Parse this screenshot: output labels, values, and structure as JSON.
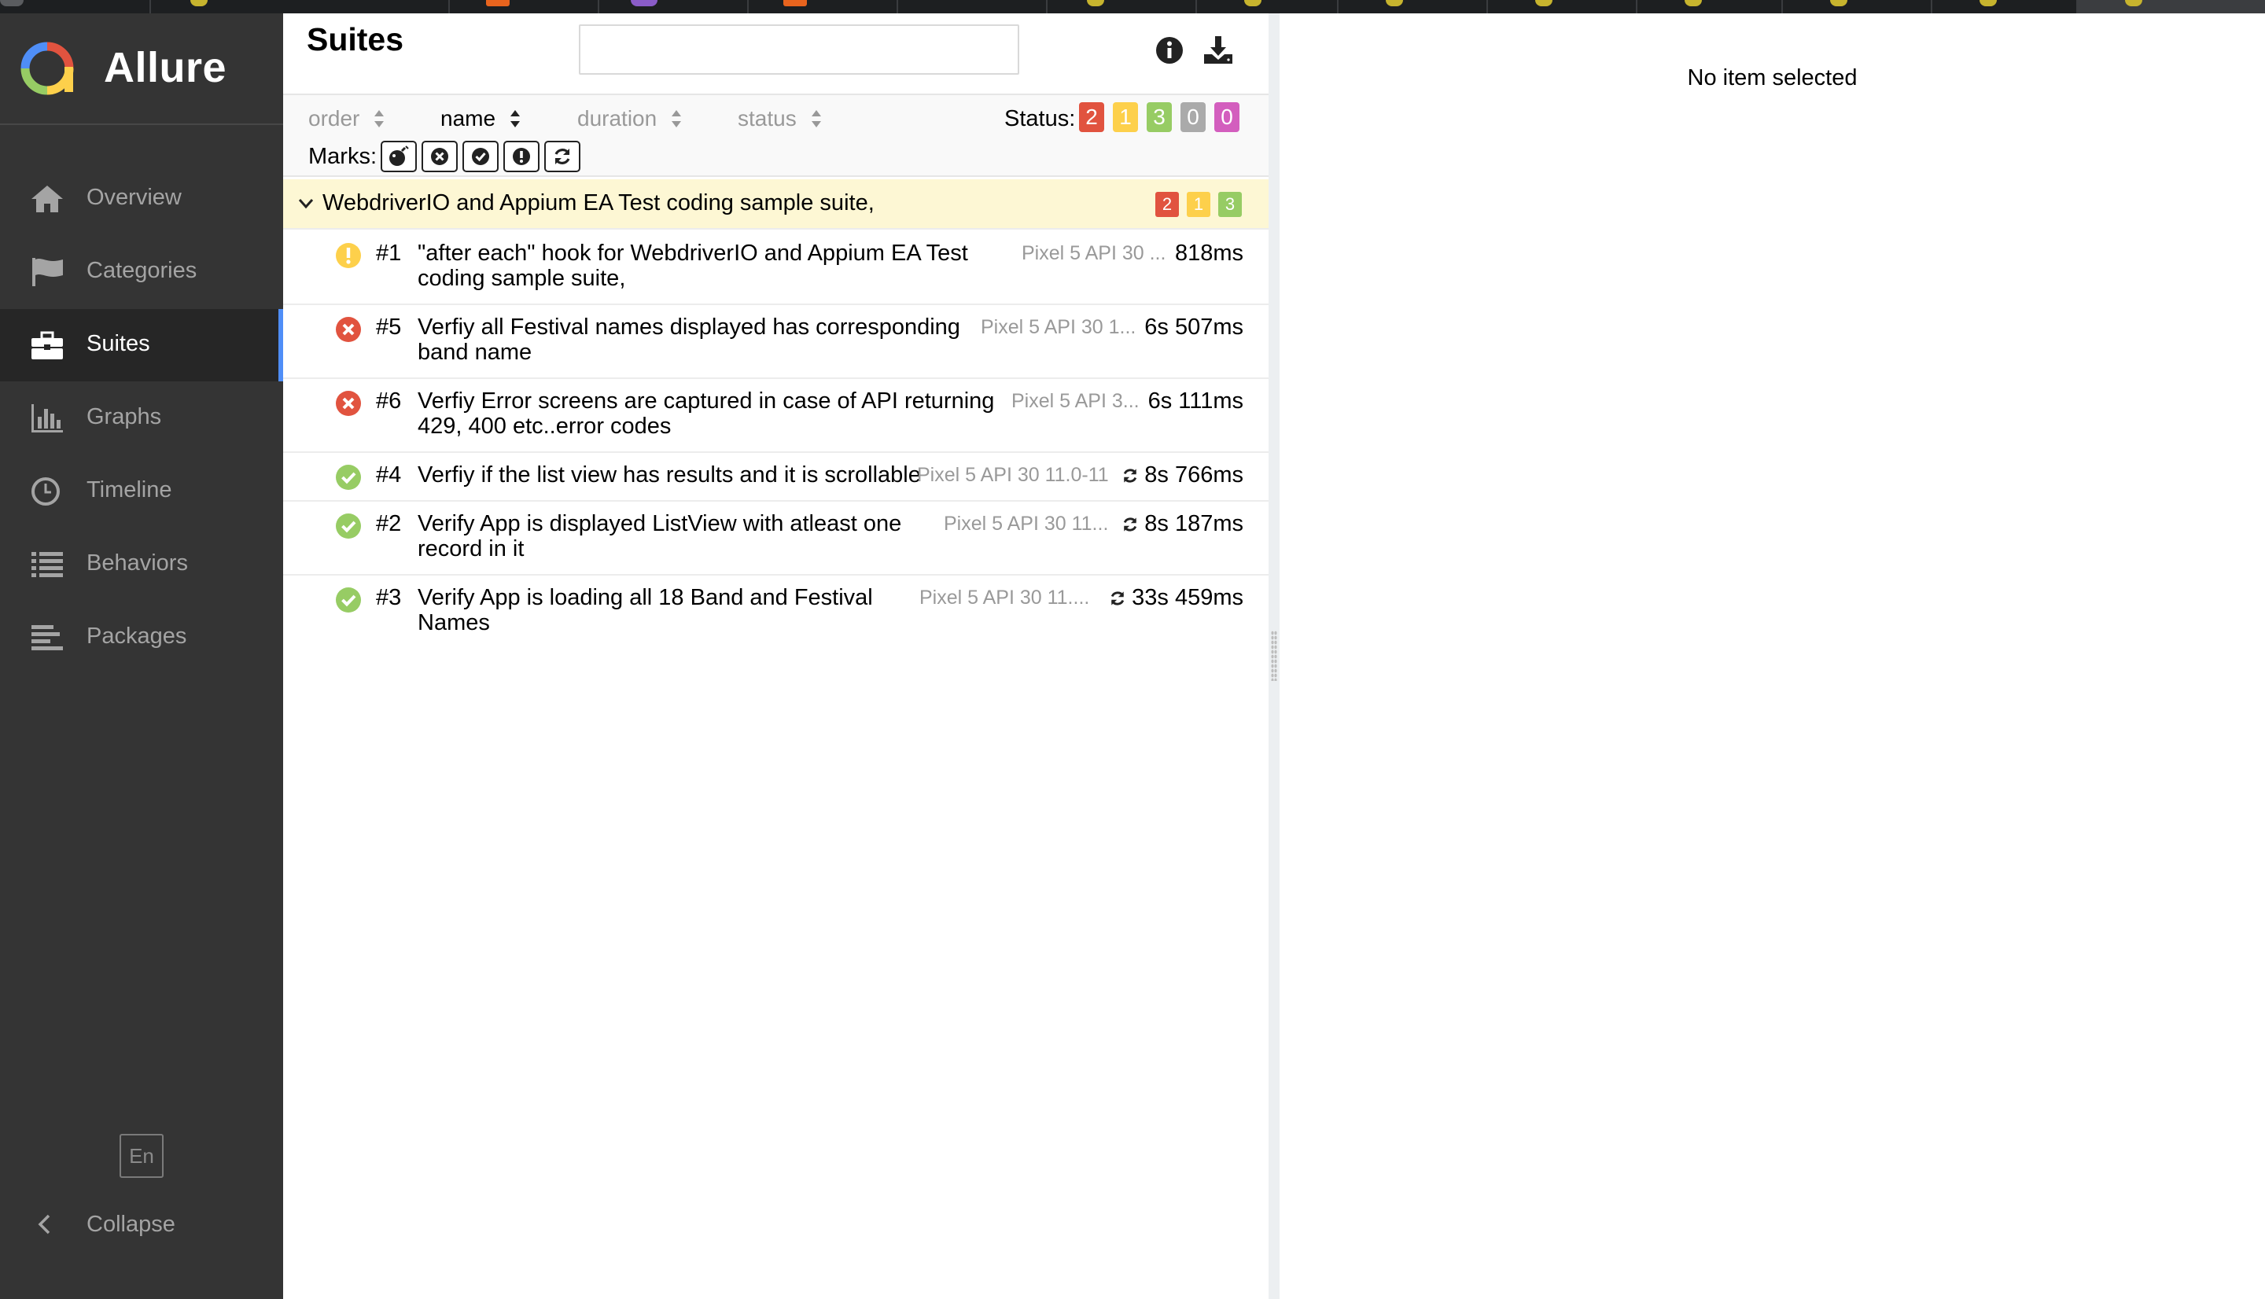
{
  "app": {
    "name": "Allure",
    "language": "En",
    "collapse_label": "Collapse"
  },
  "colors": {
    "failed": "#e1533f",
    "broken": "#fdd04b",
    "passed": "#97cc64",
    "skipped": "#aaaaaa",
    "unknown": "#d35ebe",
    "accent": "#4f8ef7"
  },
  "sidebar": {
    "items": [
      {
        "label": "Overview",
        "icon": "home-icon"
      },
      {
        "label": "Categories",
        "icon": "flag-icon"
      },
      {
        "label": "Suites",
        "icon": "briefcase-icon",
        "active": true
      },
      {
        "label": "Graphs",
        "icon": "bar-chart-icon"
      },
      {
        "label": "Timeline",
        "icon": "clock-icon"
      },
      {
        "label": "Behaviors",
        "icon": "list-icon"
      },
      {
        "label": "Packages",
        "icon": "align-left-icon"
      }
    ]
  },
  "pane": {
    "title": "Suites",
    "search_placeholder": "",
    "sort": {
      "order": "order",
      "name": "name",
      "duration": "duration",
      "status": "status"
    },
    "status_label": "Status:",
    "status_counts": {
      "failed": "2",
      "broken": "1",
      "passed": "3",
      "skipped": "0",
      "unknown": "0"
    },
    "marks_label": "Marks:",
    "group": {
      "name": "WebdriverIO and Appium EA Test coding sample suite,",
      "failed": "2",
      "broken": "1",
      "passed": "3"
    },
    "tests": [
      {
        "num": "#1",
        "status": "broken",
        "name1": "\"after each\" hook for WebdriverIO and Appium EA Test",
        "name2": "coding sample suite,",
        "param": "Pixel 5 API 30 ...",
        "duration": "818ms",
        "retry": false
      },
      {
        "num": "#5",
        "status": "failed",
        "name1": "Verfiy all Festival names displayed has corresponding",
        "name2": "band name",
        "param": "Pixel 5 API 30 1...",
        "duration": "6s 507ms",
        "retry": false
      },
      {
        "num": "#6",
        "status": "failed",
        "name1": "Verfiy Error screens are captured in case of API returning",
        "name2": "429, 400 etc..error codes",
        "param": "Pixel 5 API 3...",
        "duration": "6s 111ms",
        "retry": false
      },
      {
        "num": "#4",
        "status": "passed",
        "name1": "Verfiy if the list view has results and it is scrollable",
        "name2": "",
        "param": "Pixel 5 API 30 11.0-11",
        "duration": "8s 766ms",
        "retry": true
      },
      {
        "num": "#2",
        "status": "passed",
        "name1": "Verify App is displayed ListView with atleast one",
        "name2": "record in it",
        "param": "Pixel 5 API 30 11...",
        "duration": "8s 187ms",
        "retry": true
      },
      {
        "num": "#3",
        "status": "passed",
        "name1": "Verify App is loading all 18 Band and Festival",
        "name2": "Names",
        "param": "Pixel 5 API 30 11....",
        "duration": "33s 459ms",
        "retry": true
      }
    ]
  },
  "details": {
    "empty_text": "No item selected"
  }
}
